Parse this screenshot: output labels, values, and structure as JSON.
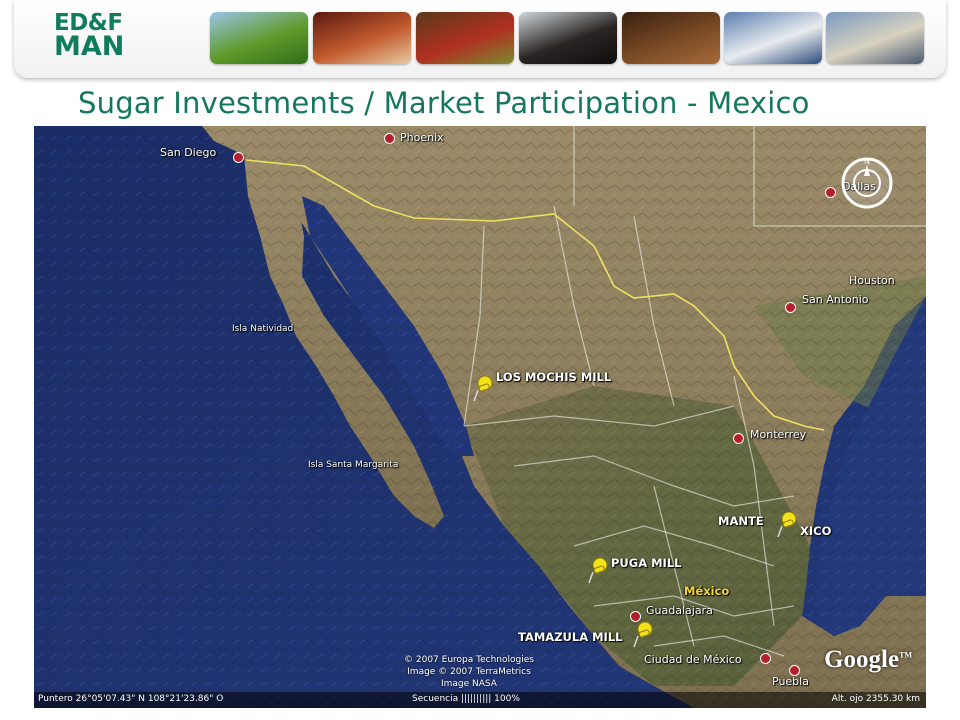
{
  "logo": {
    "line1": "ED&F",
    "line2": "MAN"
  },
  "photos": [
    {
      "name": "sugarcane-field-photo",
      "colors": [
        "#9ac4e8",
        "#5f9a2a",
        "#2f6e1b"
      ]
    },
    {
      "name": "cocoa-pod-photo",
      "colors": [
        "#5c1a10",
        "#c25a2e",
        "#e8c9a0"
      ]
    },
    {
      "name": "coffee-cherries-photo",
      "colors": [
        "#5a3a1a",
        "#b03020",
        "#7a8a30"
      ]
    },
    {
      "name": "molasses-pour-photo",
      "colors": [
        "#cfd6da",
        "#2a2523",
        "#0e0c0b"
      ]
    },
    {
      "name": "coffee-beans-photo",
      "colors": [
        "#3a2010",
        "#7a4a25",
        "#a66a38"
      ]
    },
    {
      "name": "ship-harbor-photo",
      "colors": [
        "#5c7fb0",
        "#e8ecef",
        "#2a4a7a"
      ]
    },
    {
      "name": "port-terminal-photo",
      "colors": [
        "#7a9ac0",
        "#d8d2c0",
        "#4a5a70"
      ]
    }
  ],
  "title": "Sugar Investments / Market Participation - Mexico",
  "map": {
    "cities": [
      {
        "name": "San Diego"
      },
      {
        "name": "Phoenix"
      },
      {
        "name": "Dallas"
      },
      {
        "name": "Houston"
      },
      {
        "name": "San Antonio"
      },
      {
        "name": "Monterrey"
      },
      {
        "name": "Guadalajara"
      },
      {
        "name": "Ciudad de México"
      },
      {
        "name": "Puebla"
      }
    ],
    "islands": [
      "Isla Natividad",
      "Isla Santa Margarita"
    ],
    "mills": [
      "LOS MOCHIS MILL",
      "MANTE",
      "XICO",
      "PUGA MILL",
      "TAMAZULA MILL"
    ],
    "country_label": "México",
    "copyright": [
      "© 2007 Europa Technologies",
      "Image © 2007 TerraMetrics",
      "Image NASA"
    ],
    "brand": "Google",
    "brand_tm": "TM",
    "compass_n": "N",
    "status": {
      "pointer": "Puntero  26°05'07.43\" N    108°21'23.86\" O",
      "stream": "Secuencia  ||||||||||  100%",
      "altitude": "Alt. ojo   2355.30 km"
    },
    "colors": {
      "ocean": "#1c2f6e",
      "land": "#8a7a5a",
      "border": "#f1e060",
      "pin": "#f2e21a"
    }
  }
}
